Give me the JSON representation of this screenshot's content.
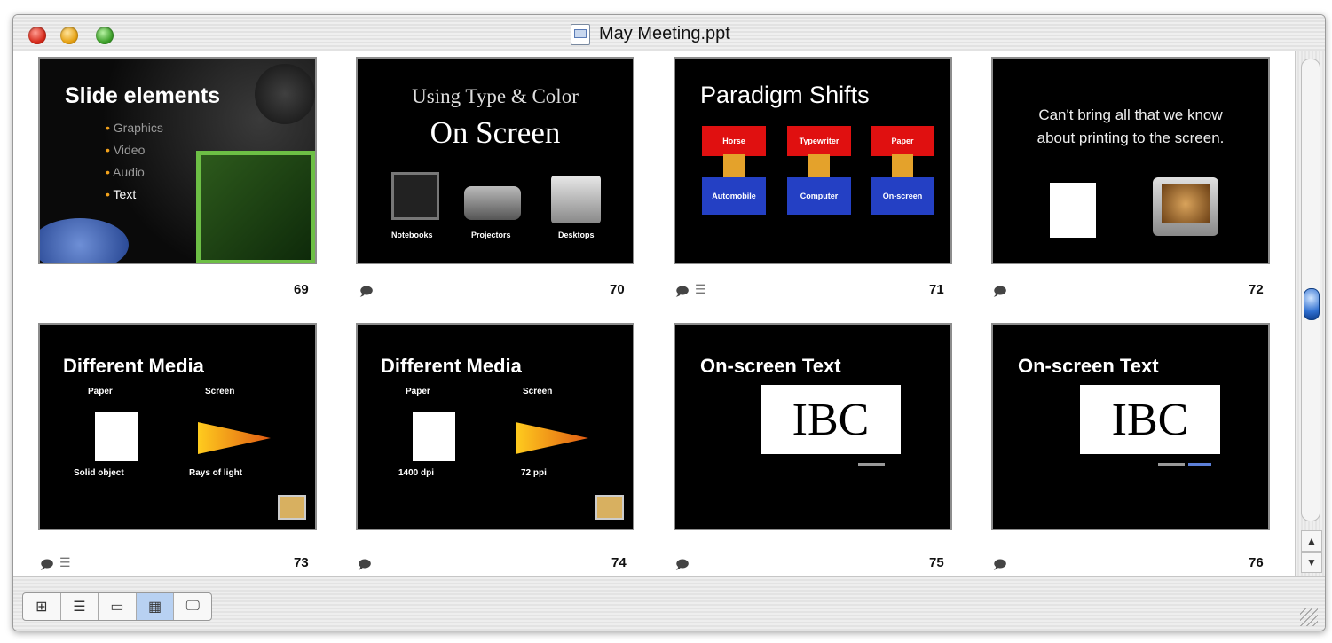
{
  "window": {
    "title": "May Meeting.ppt"
  },
  "slides": [
    {
      "number": "69",
      "title": "Slide elements",
      "bullets": [
        "Graphics",
        "Video",
        "Audio",
        "Text"
      ]
    },
    {
      "number": "70",
      "line1": "Using Type & Color",
      "line2": "On Screen",
      "labels": [
        "Notebooks",
        "Projectors",
        "Desktops"
      ]
    },
    {
      "number": "71",
      "title": "Paradigm Shifts",
      "top_boxes": [
        "Horse",
        "Typewriter",
        "Paper"
      ],
      "bottom_boxes": [
        "Automobile",
        "Computer",
        "On-screen"
      ]
    },
    {
      "number": "72",
      "line1": "Can't bring all that we know",
      "line2": "about printing to the screen."
    },
    {
      "number": "73",
      "title": "Different Media",
      "col1": "Paper",
      "col2": "Screen",
      "cap1": "Solid object",
      "cap2": "Rays of light"
    },
    {
      "number": "74",
      "title": "Different Media",
      "col1": "Paper",
      "col2": "Screen",
      "cap1": "1400 dpi",
      "cap2": "72 ppi"
    },
    {
      "number": "75",
      "title": "On-screen Text",
      "box": "IBC"
    },
    {
      "number": "76",
      "title": "On-screen Text",
      "box": "IBC"
    }
  ],
  "view_buttons": [
    "normal-view",
    "outline-view",
    "slide-view",
    "slide-sorter-view",
    "slide-show"
  ],
  "icons": {
    "note": "speaker-note-icon",
    "list": "list-icon"
  }
}
